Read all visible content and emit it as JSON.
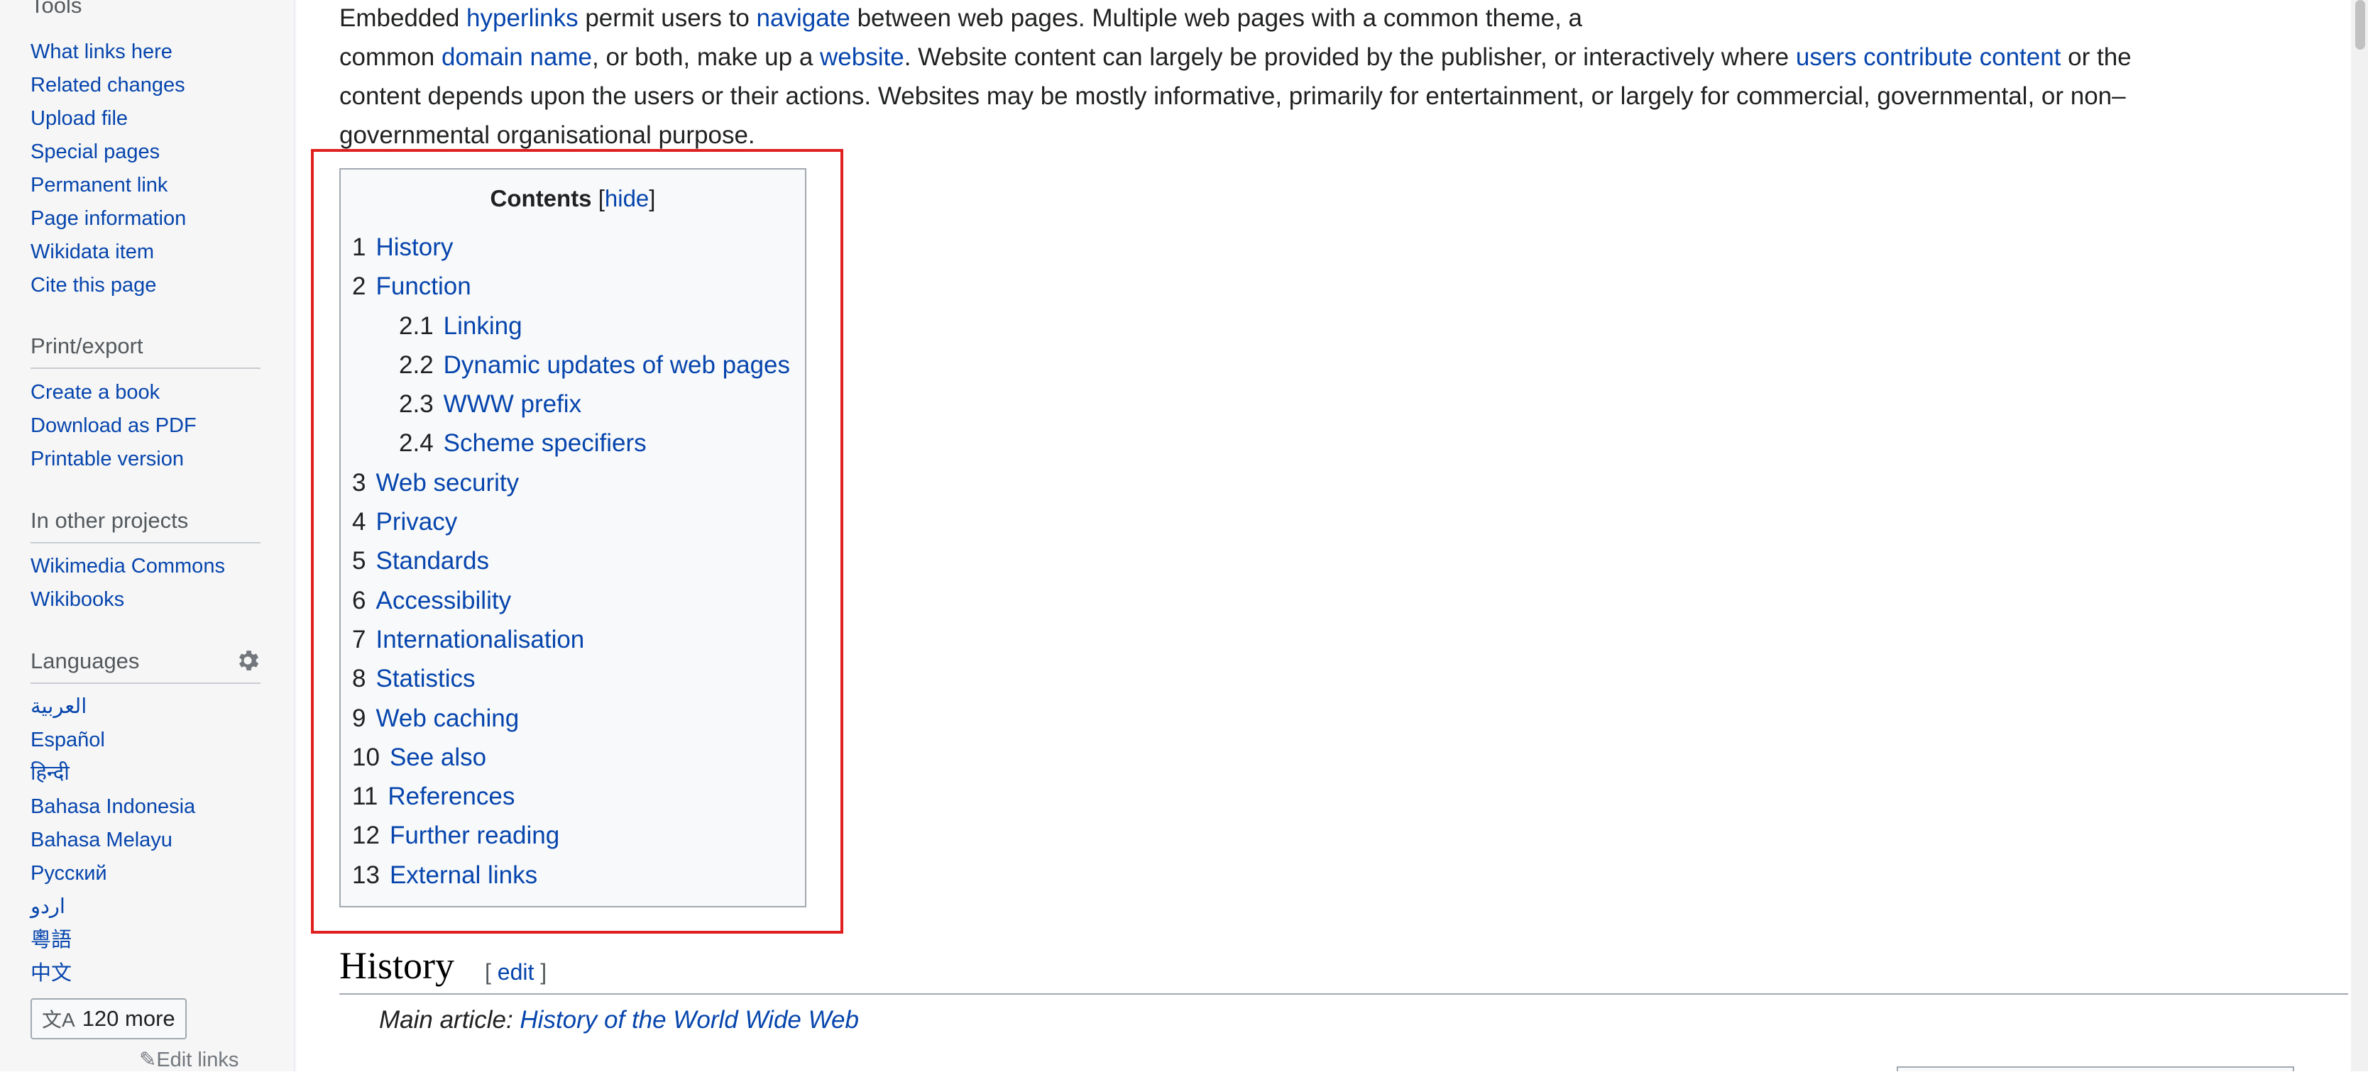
{
  "sidebar": {
    "tools_heading": "Tools",
    "tools": [
      "What links here",
      "Related changes",
      "Upload file",
      "Special pages",
      "Permanent link",
      "Page information",
      "Wikidata item",
      "Cite this page"
    ],
    "print_heading": "Print/export",
    "print": [
      "Create a book",
      "Download as PDF",
      "Printable version"
    ],
    "projects_heading": "In other projects",
    "projects": [
      "Wikimedia Commons",
      "Wikibooks"
    ],
    "languages_heading": "Languages",
    "languages": [
      "العربية",
      "Español",
      "हिन्दी",
      "Bahasa Indonesia",
      "Bahasa Melayu",
      "Русский",
      "اردو",
      "粵語",
      "中文"
    ],
    "more_languages": "120 more",
    "edit_links": "Edit links"
  },
  "article": {
    "intro": {
      "l1_a": "Embedded ",
      "l1_link1": "hyperlinks",
      "l1_b": " permit users to ",
      "l1_link2": "navigate",
      "l1_c": " between web pages. Multiple web pages with a common theme, a",
      "l2_a": "common ",
      "l2_link1": "domain name",
      "l2_b": ", or both, make up a ",
      "l2_link2": "website",
      "l2_c": ". Website content can largely be provided by the publisher, or interactively where ",
      "l2_link3": "users contribute content",
      "l2_d": " or the",
      "l3": "content depends upon the users or their actions. Websites may be mostly informative, primarily for entertainment, or largely for commercial, governmental, or non–",
      "l4": "governmental organisational purpose."
    },
    "toc": {
      "title": "Contents",
      "toggle": "hide",
      "items": [
        {
          "num": "1",
          "text": "History",
          "level": 1
        },
        {
          "num": "2",
          "text": "Function",
          "level": 1
        },
        {
          "num": "2.1",
          "text": "Linking",
          "level": 2
        },
        {
          "num": "2.2",
          "text": "Dynamic updates of web pages",
          "level": 2
        },
        {
          "num": "2.3",
          "text": "WWW prefix",
          "level": 2
        },
        {
          "num": "2.4",
          "text": "Scheme specifiers",
          "level": 2
        },
        {
          "num": "3",
          "text": "Web security",
          "level": 1
        },
        {
          "num": "4",
          "text": "Privacy",
          "level": 1
        },
        {
          "num": "5",
          "text": "Standards",
          "level": 1
        },
        {
          "num": "6",
          "text": "Accessibility",
          "level": 1
        },
        {
          "num": "7",
          "text": "Internationalisation",
          "level": 1
        },
        {
          "num": "8",
          "text": "Statistics",
          "level": 1
        },
        {
          "num": "9",
          "text": "Web caching",
          "level": 1
        },
        {
          "num": "10",
          "text": "See also",
          "level": 1
        },
        {
          "num": "11",
          "text": "References",
          "level": 1
        },
        {
          "num": "12",
          "text": "Further reading",
          "level": 1
        },
        {
          "num": "13",
          "text": "External links",
          "level": 1
        }
      ]
    },
    "history": {
      "heading": "History",
      "edit": "edit",
      "hatnote_prefix": "Main article: ",
      "hatnote_link": "History of the World Wide Web"
    }
  }
}
